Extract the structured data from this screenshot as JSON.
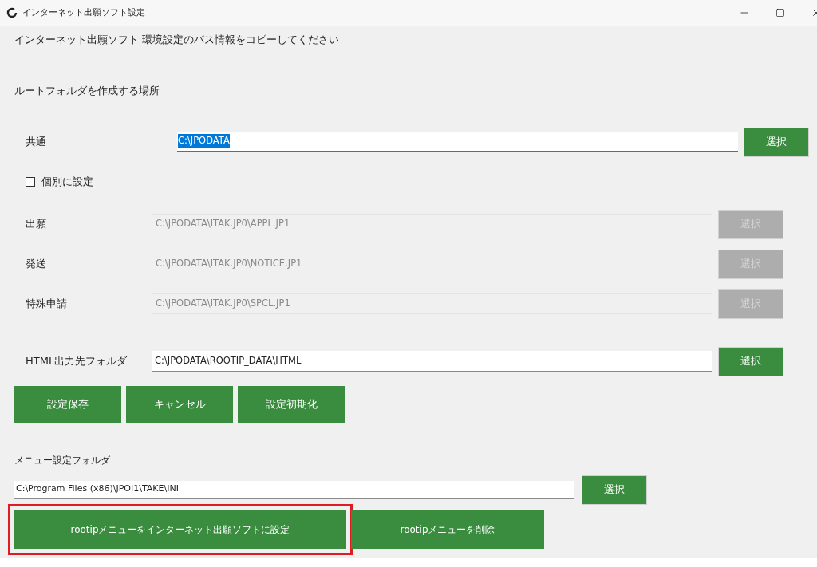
{
  "window": {
    "title": "インターネット出願ソフト設定"
  },
  "instruction": "インターネット出願ソフト 環境設定のパス情報をコピーしてください",
  "root_section": {
    "label": "ルートフォルダを作成する場所"
  },
  "common": {
    "label": "共通",
    "value": "C:\\JPODATA",
    "focused": true,
    "text_selected": true,
    "button": "選択"
  },
  "individual_checkbox": {
    "label": "個別に設定",
    "checked": false
  },
  "paths": [
    {
      "label": "出願",
      "value": "C:\\JPODATA\\ITAK.JP0\\APPL.JP1",
      "disabled": true,
      "button": "選択"
    },
    {
      "label": "発送",
      "value": "C:\\JPODATA\\ITAK.JP0\\NOTICE.JP1",
      "disabled": true,
      "button": "選択"
    },
    {
      "label": "特殊申請",
      "value": "C:\\JPODATA\\ITAK.JP0\\SPCL.JP1",
      "disabled": true,
      "button": "選択"
    }
  ],
  "html_folder": {
    "label": "HTML出力先フォルダ",
    "value": "C:\\JPODATA\\ROOTIP_DATA\\HTML",
    "disabled": false,
    "button": "選択"
  },
  "actions": [
    "設定保存",
    "キャンセル",
    "設定初期化"
  ],
  "menu_folder": {
    "label": "メニュー設定フォルダ",
    "value": "C:\\Program Files (x86)\\JPOI1\\TAKE\\INI",
    "button": "選択"
  },
  "menu_actions": [
    {
      "label": "rootipメニューをインターネット出願ソフトに設定",
      "highlighted": true
    },
    {
      "label": "rootipメニューを削除",
      "highlighted": false
    }
  ]
}
